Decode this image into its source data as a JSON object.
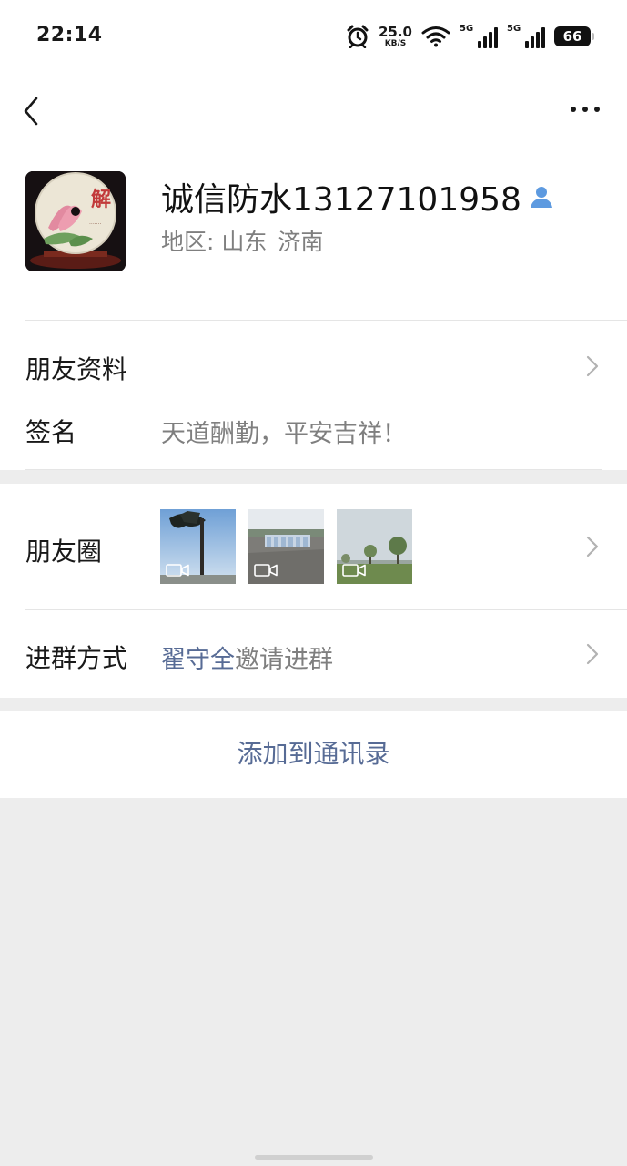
{
  "status_bar": {
    "time": "22:14",
    "net_speed_value": "25.0",
    "net_speed_unit": "KB/S",
    "sim1_label": "5G",
    "sim2_label": "5G",
    "battery": "66"
  },
  "profile": {
    "name": "诚信防水13127101958",
    "region_label": "地区:",
    "region_province": "山东",
    "region_city": "济南"
  },
  "rows": {
    "friend_info_label": "朋友资料",
    "signature_label": "签名",
    "signature_value": "天道酬勤，平安吉祥！",
    "moments_label": "朋友圈",
    "join_method_label": "进群方式",
    "join_inviter": "翟守全",
    "join_method_suffix": "邀请进群"
  },
  "moments_thumbs": [
    {
      "kind": "video",
      "scene": "tree-sky"
    },
    {
      "kind": "video",
      "scene": "industrial-yard"
    },
    {
      "kind": "video",
      "scene": "park-trees"
    }
  ],
  "actions": {
    "add_to_contacts_label": "添加到通讯录"
  },
  "colors": {
    "link_blue": "#576b95",
    "secondary_text": "#7f7f7f",
    "background_gray": "#ededed",
    "contact_badge_blue": "#5d9ae0"
  },
  "icons": [
    "alarm-icon",
    "wifi-icon",
    "signal-icon",
    "battery-icon",
    "back-icon",
    "more-icon",
    "contact-badge-icon",
    "chevron-right-icon",
    "video-icon"
  ]
}
